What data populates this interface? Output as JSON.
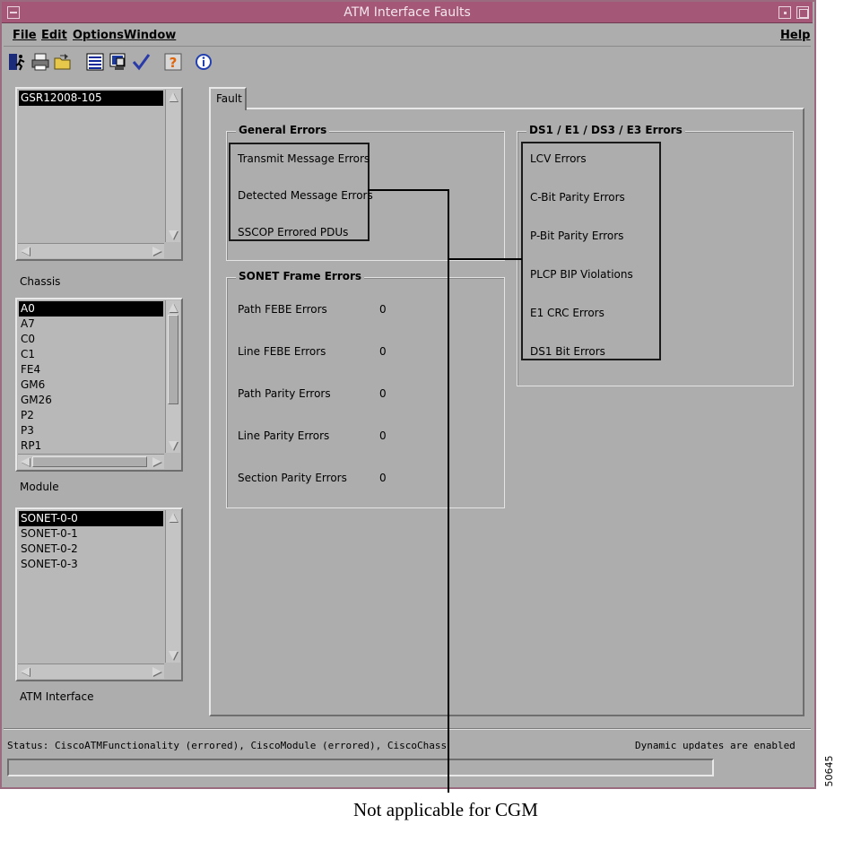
{
  "window": {
    "title": "ATM Interface Faults"
  },
  "menubar": {
    "file": "File",
    "edit": "Edit",
    "options": "Options",
    "window": "Window",
    "help": "Help"
  },
  "toolbar": {
    "icons": [
      "exit-icon",
      "printer-icon",
      "open-folder-icon",
      "list-icon",
      "monitor-icon",
      "checkmark-icon",
      "help-question-icon",
      "info-icon"
    ]
  },
  "chassis_list": {
    "items": [
      "GSR12008-105"
    ],
    "selected": "GSR12008-105",
    "label": "Chassis"
  },
  "module_list": {
    "items": [
      "A0",
      "A7",
      "C0",
      "C1",
      "FE4",
      "GM6",
      "GM26",
      "P2",
      "P3",
      "RP1"
    ],
    "selected": "A0",
    "label": "Module"
  },
  "atm_list": {
    "items": [
      "SONET-0-0",
      "SONET-0-1",
      "SONET-0-2",
      "SONET-0-3"
    ],
    "selected": "SONET-0-0",
    "label": "ATM Interface"
  },
  "tab": {
    "label": "Fault"
  },
  "general_errors": {
    "title": "General Errors",
    "fields": [
      "Transmit Message Errors",
      "Detected Message Errors",
      "SSCOP Errored PDUs"
    ]
  },
  "sonet_errors": {
    "title": "SONET Frame Errors",
    "fields": [
      {
        "label": "Path FEBE Errors",
        "value": "0"
      },
      {
        "label": "Line FEBE Errors",
        "value": "0"
      },
      {
        "label": "Path Parity Errors",
        "value": "0"
      },
      {
        "label": "Line Parity Errors",
        "value": "0"
      },
      {
        "label": "Section Parity Errors",
        "value": "0"
      }
    ]
  },
  "ds_errors": {
    "title": "DS1 / E1 / DS3 / E3 Errors",
    "fields": [
      "LCV Errors",
      "C-Bit Parity Errors",
      "P-Bit Parity Errors",
      "PLCP BIP Violations",
      "E1 CRC Errors",
      "DS1 Bit Errors"
    ]
  },
  "status": {
    "text": "Status: CiscoATMFunctionality (errored), CiscoModule (errored), CiscoChassis (norm",
    "right": "Dynamic updates are enabled"
  },
  "callout": {
    "text": "Not applicable for CGM"
  },
  "figure_id": "50645"
}
